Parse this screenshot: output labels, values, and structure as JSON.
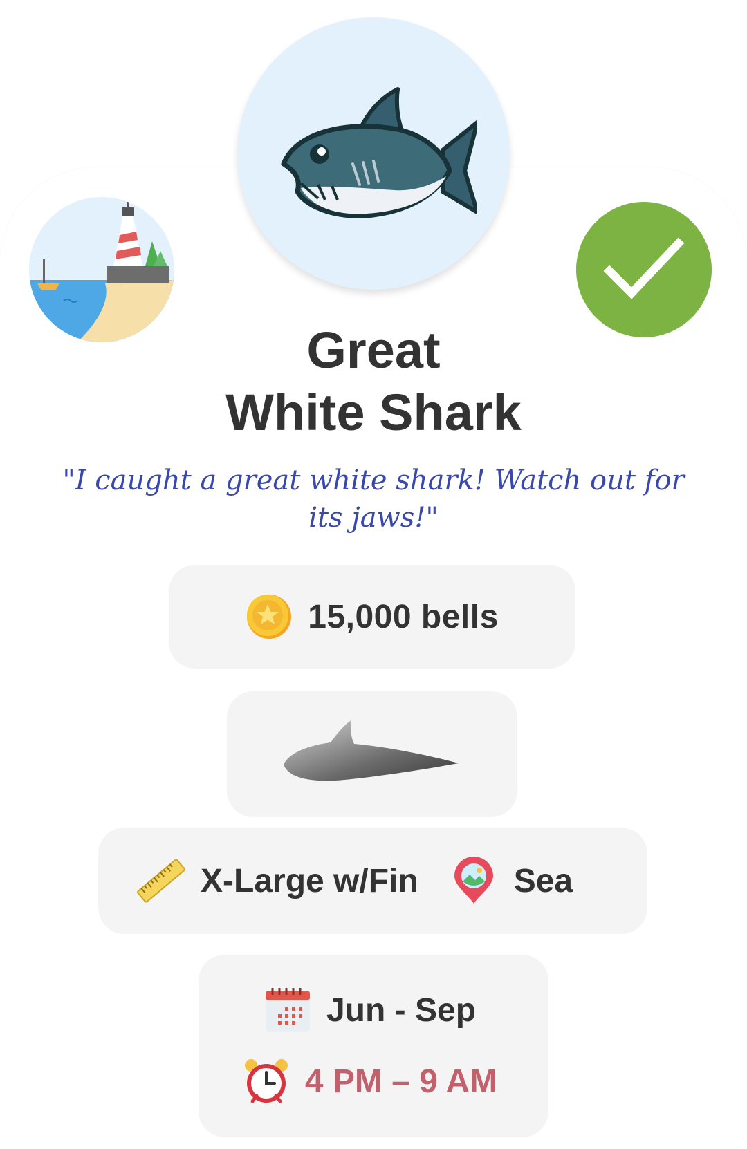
{
  "creature": {
    "name_line1": "Great",
    "name_line2": "White Shark",
    "quote": "\"I caught a great white shark! Watch out for its jaws!\"",
    "caught": true
  },
  "price": {
    "text": "15,000 bells",
    "icon": "coin-icon"
  },
  "shadow": {
    "icon": "fin-shadow-icon"
  },
  "info": {
    "size": "X-Large w/Fin",
    "size_icon": "ruler-icon",
    "location": "Sea",
    "location_icon": "map-pin-icon"
  },
  "availability": {
    "months": "Jun - Sep",
    "months_icon": "calendar-icon",
    "hours": "4 PM – 9 AM",
    "hours_icon": "alarm-clock-icon",
    "hours_color": "#c0616d"
  },
  "colors": {
    "caught_check": "#7cb342",
    "hero_bg": "#e3f1fd",
    "quote": "#3949ab",
    "title": "#333333"
  }
}
